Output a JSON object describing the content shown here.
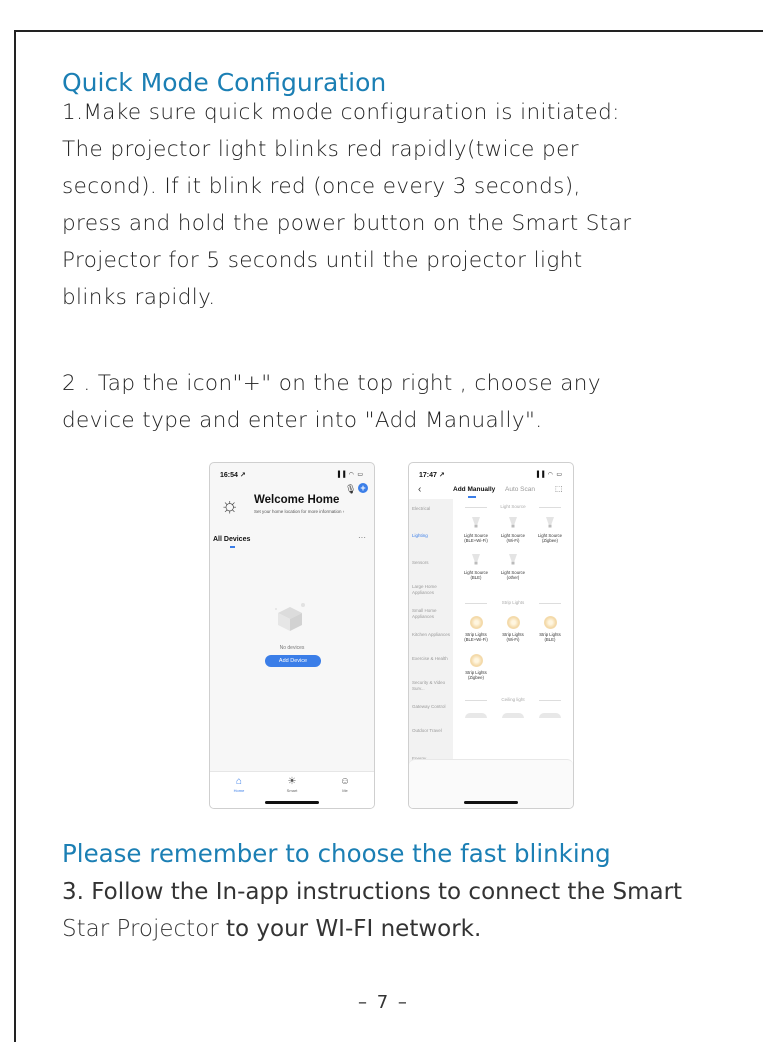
{
  "heading": "Quick Mode Configuration",
  "step1_lines": [
    "1.Make sure quick mode configuration is initiated:",
    "The projector light blinks red rapidly(twice per",
    "second). If it blink red (once every 3 seconds),",
    "press and hold the power button on the Smart Star",
    "Projector for 5 seconds until the projector light",
    "blinks rapidly."
  ],
  "step2_lines": [
    "2 . Tap the icon\"+\" on the top right , choose any",
    "device type and enter into \"Add Manually\"."
  ],
  "phone1": {
    "time": "16:54 ↗",
    "status_icons": "▐▐ ◠ ▭",
    "welcome_title": "Welcome Home",
    "welcome_subtitle": "Set your home location for more information  ›",
    "all_devices": "All Devices",
    "more": "···",
    "no_devices": "No devices",
    "add_device": "Add Device",
    "tabs": [
      {
        "label": "Home",
        "icon": "⌂"
      },
      {
        "label": "Smart",
        "icon": "☀"
      },
      {
        "label": "Me",
        "icon": "☺"
      }
    ]
  },
  "phone2": {
    "time": "17:47 ↗",
    "status_icons": "▐▐ ◠ ▭",
    "back": "‹",
    "tab_add_manually": "Add Manually",
    "tab_auto_scan": "Auto Scan",
    "scan_icon": "⬚",
    "categories": [
      "Electrical",
      "Lighting",
      "Sensors",
      "Large Home Appliances",
      "Small Home Appliances",
      "Kitchen Appliances",
      "Exercise & Health",
      "Security & Video Surv...",
      "Gateway Control",
      "Outdoor Travel",
      "Energy"
    ],
    "section_light_source": "Light Source",
    "section_strip_lights": "Strip Lights",
    "section_ceiling_light": "Ceiling light",
    "light_sources": [
      [
        "Light Source",
        "(BLE+Wi-Fi)"
      ],
      [
        "Light Source",
        "(Wi-Fi)"
      ],
      [
        "Light Source",
        "(Zigbee)"
      ],
      [
        "Light Source",
        "(BLE)"
      ],
      [
        "Light Source",
        "(other)"
      ]
    ],
    "strip_lights": [
      [
        "Strip Lights",
        "(BLE+Wi-Fi)"
      ],
      [
        "Strip Lights",
        "(Wi-Fi)"
      ],
      [
        "Strip Lights",
        "(BLE)"
      ],
      [
        "Strip Lights",
        "(Zigbee)"
      ]
    ]
  },
  "reminder": "Please remember to choose the fast blinking",
  "step3_line1": "3.  Follow the In-app instructions to connect the Smart",
  "step3_line2_a": "Star Projector",
  "step3_line2_b": " to your WI-FI network.",
  "page_number": "– 7 –"
}
